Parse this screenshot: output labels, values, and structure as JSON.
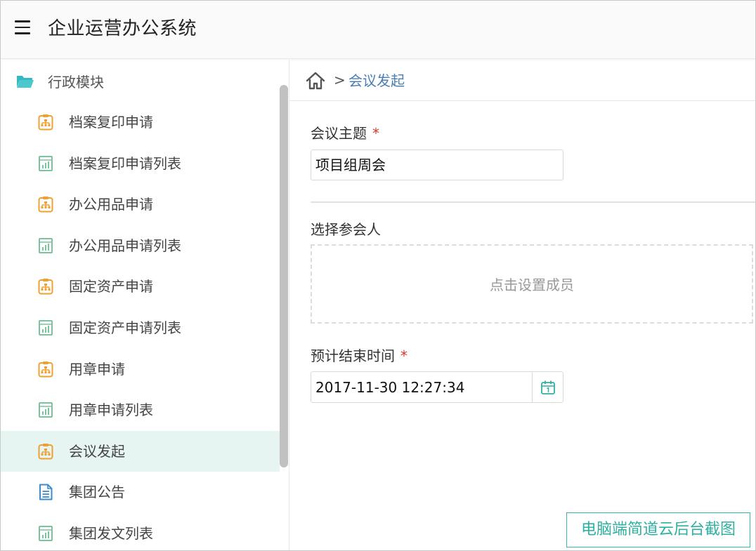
{
  "header": {
    "menu_icon": "hamburger-menu-icon",
    "title": "企业运营办公系统"
  },
  "sidebar": {
    "group": {
      "icon": "folder-open-icon",
      "label": "行政模块"
    },
    "items": [
      {
        "label": "档案复印申请",
        "icon": "form-icon"
      },
      {
        "label": "档案复印申请列表",
        "icon": "report-list-icon"
      },
      {
        "label": "办公用品申请",
        "icon": "form-icon"
      },
      {
        "label": "办公用品申请列表",
        "icon": "report-list-icon"
      },
      {
        "label": "固定资产申请",
        "icon": "form-icon"
      },
      {
        "label": "固定资产申请列表",
        "icon": "report-list-icon"
      },
      {
        "label": "用章申请",
        "icon": "form-icon"
      },
      {
        "label": "用章申请列表",
        "icon": "report-list-icon"
      },
      {
        "label": "会议发起",
        "icon": "form-icon",
        "active": true
      },
      {
        "label": "集团公告",
        "icon": "document-icon"
      },
      {
        "label": "集团发文列表",
        "icon": "report-list-icon"
      }
    ]
  },
  "breadcrumb": {
    "home_icon": "home-icon",
    "separator": ">",
    "current": "会议发起"
  },
  "form": {
    "topic": {
      "label": "会议主题",
      "required_mark": "*",
      "value": "项目组周会"
    },
    "participants": {
      "label": "选择参会人",
      "hint": "点击设置成员"
    },
    "end_time": {
      "label": "预计结束时间",
      "required_mark": "*",
      "value": "2017-11-30 12:27:34",
      "icon": "calendar-icon"
    }
  },
  "watermark": "电脑端简道云后台截图",
  "colors": {
    "accent_teal": "#2fb0a0",
    "form_icon_orange": "#f0a030",
    "list_icon_green": "#7cc4a0",
    "doc_icon_blue": "#3b8bd0",
    "active_row": "#e6f5f2",
    "breadcrumb_link": "#4a7fb5",
    "required": "#d03a2d"
  }
}
